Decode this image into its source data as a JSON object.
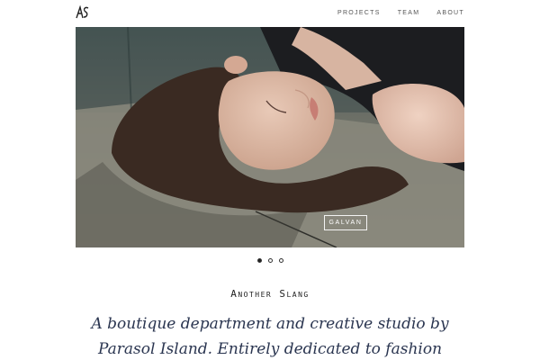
{
  "header": {
    "logo_text": "AS",
    "nav": [
      {
        "label": "PROJECTS"
      },
      {
        "label": "TEAM"
      },
      {
        "label": "ABOUT"
      }
    ]
  },
  "hero": {
    "label": "GALVAN",
    "slides_total": 3,
    "active_slide": 1
  },
  "intro": {
    "name": "Another Slang",
    "tagline": "A boutique department and creative studio by Parasol Island. Entirely dedicated to fashion"
  }
}
